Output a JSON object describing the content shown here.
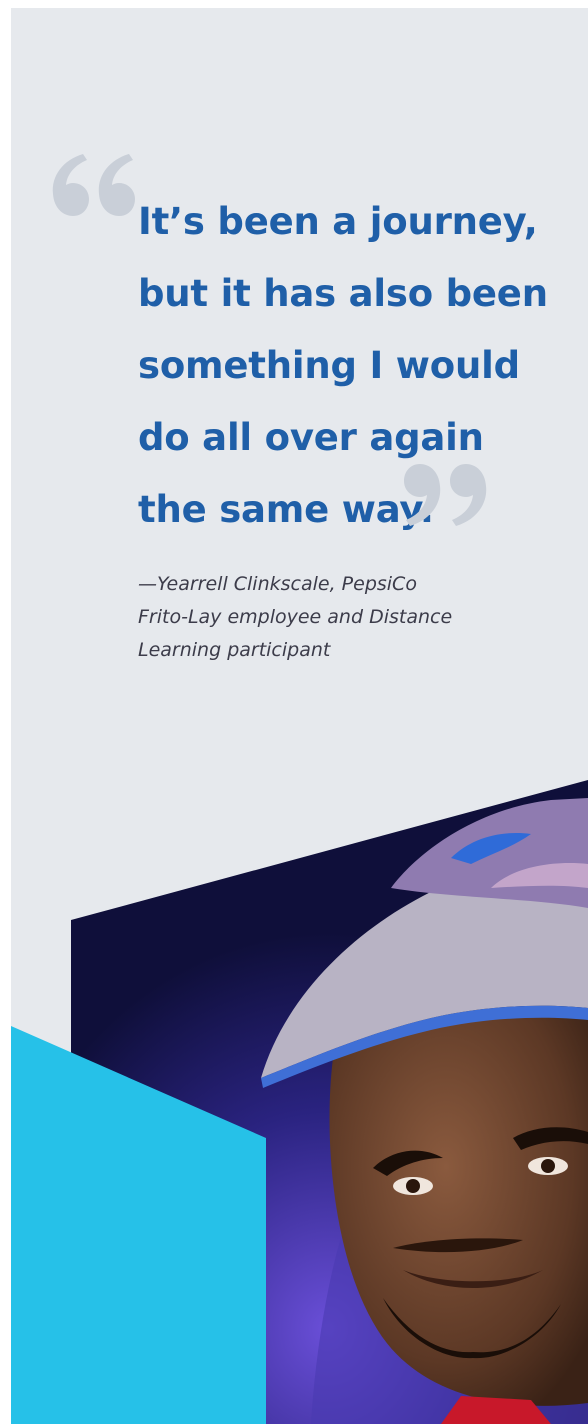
{
  "quote": {
    "lines": [
      "It’s been a journey,",
      "but it has also been",
      "something I would",
      "do all over again",
      "the same way."
    ]
  },
  "attribution": {
    "lines": [
      "—Yearrell Clinkscale, PepsiCo",
      "Frito-Lay employee and Distance",
      "Learning participant"
    ]
  },
  "icons": {
    "open_quote": "open-quote-mark-icon",
    "close_quote": "close-quote-mark-icon"
  },
  "colors": {
    "background": "#e6e9ed",
    "quote_text": "#1f5fa8",
    "quote_marks": "#c9cfd8",
    "accent_cyan": "#26c1e8",
    "photo_dark": "#0f0f3a"
  }
}
